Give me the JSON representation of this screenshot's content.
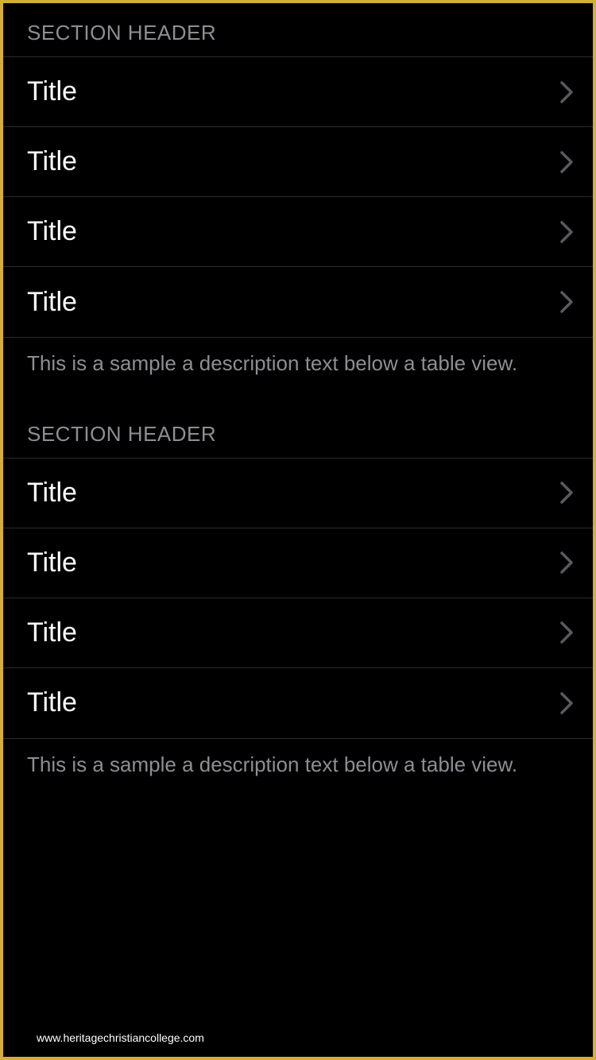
{
  "sections": [
    {
      "header": "SECTION HEADER",
      "rows": [
        {
          "title": "Title"
        },
        {
          "title": "Title"
        },
        {
          "title": "Title"
        },
        {
          "title": "Title"
        }
      ],
      "footer": "This is a sample a description text below a table view."
    },
    {
      "header": "SECTION HEADER",
      "rows": [
        {
          "title": "Title"
        },
        {
          "title": "Title"
        },
        {
          "title": "Title"
        },
        {
          "title": "Title"
        }
      ],
      "footer": "This is a sample a description text below a table view."
    }
  ],
  "watermark": "www.heritagechristiancollege.com"
}
